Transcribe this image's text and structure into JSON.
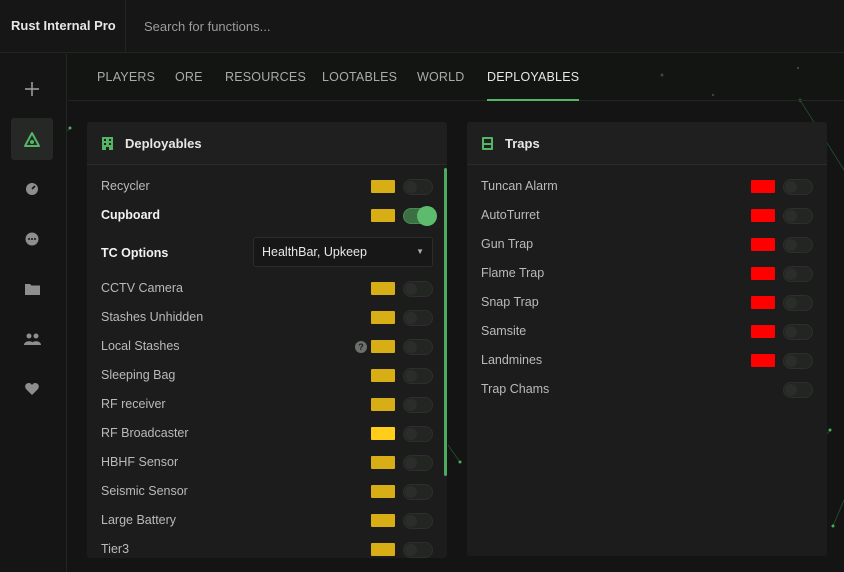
{
  "app": {
    "title": "Rust Internal Pro",
    "search_placeholder": "Search for functions..."
  },
  "sidebar": {
    "items": [
      {
        "icon": "crosshair-icon",
        "active": false
      },
      {
        "icon": "eye-triangle-icon",
        "active": true
      },
      {
        "icon": "gauge-icon",
        "active": false
      },
      {
        "icon": "chat-dots-icon",
        "active": false
      },
      {
        "icon": "folder-icon",
        "active": false
      },
      {
        "icon": "users-icon",
        "active": false
      },
      {
        "icon": "heart-icon",
        "active": false
      }
    ]
  },
  "tabs": [
    {
      "label": "PLAYERS",
      "active": false
    },
    {
      "label": "ORE",
      "active": false
    },
    {
      "label": "RESOURCES",
      "active": false
    },
    {
      "label": "LOOTABLES",
      "active": false
    },
    {
      "label": "WORLD",
      "active": false
    },
    {
      "label": "DEPLOYABLES",
      "active": true
    }
  ],
  "colors": {
    "accent": "#54b564",
    "swatch_yellow": "#d8ae17",
    "swatch_yellow_bright": "#ffcd1a",
    "swatch_red": "#ff0000"
  },
  "deployables": {
    "title": "Deployables",
    "icon": "building-icon",
    "tc_options": {
      "label": "TC Options",
      "value": "HealthBar, Upkeep"
    },
    "items": [
      {
        "label": "Recycler",
        "color": "#d8ae17",
        "on": false,
        "help": false
      },
      {
        "label": "Cupboard",
        "color": "#d8ae17",
        "on": true,
        "help": false
      },
      {
        "label": "CCTV Camera",
        "color": "#d8ae17",
        "on": false,
        "help": false
      },
      {
        "label": "Stashes Unhidden",
        "color": "#d8ae17",
        "on": false,
        "help": false
      },
      {
        "label": "Local Stashes",
        "color": "#d8ae17",
        "on": false,
        "help": true
      },
      {
        "label": "Sleeping Bag",
        "color": "#d8ae17",
        "on": false,
        "help": false
      },
      {
        "label": "RF receiver",
        "color": "#d8ae17",
        "on": false,
        "help": false
      },
      {
        "label": "RF Broadcaster",
        "color": "#ffcd1a",
        "on": false,
        "help": false
      },
      {
        "label": "HBHF Sensor",
        "color": "#d8ae17",
        "on": false,
        "help": false
      },
      {
        "label": "Seismic Sensor",
        "color": "#d8ae17",
        "on": false,
        "help": false
      },
      {
        "label": "Large Battery",
        "color": "#d8ae17",
        "on": false,
        "help": false
      },
      {
        "label": "Tier3",
        "color": "#d8ae17",
        "on": false,
        "help": false
      }
    ]
  },
  "traps": {
    "title": "Traps",
    "icon": "trap-box-icon",
    "items": [
      {
        "label": "Tuncan Alarm",
        "color": "#ff0000",
        "on": false
      },
      {
        "label": "AutoTurret",
        "color": "#ff0000",
        "on": false
      },
      {
        "label": "Gun Trap",
        "color": "#ff0000",
        "on": false
      },
      {
        "label": "Flame Trap",
        "color": "#ff0000",
        "on": false
      },
      {
        "label": "Snap Trap",
        "color": "#ff0000",
        "on": false
      },
      {
        "label": "Samsite",
        "color": "#ff0000",
        "on": false
      },
      {
        "label": "Landmines",
        "color": "#ff0000",
        "on": false
      },
      {
        "label": "Trap Chams",
        "color": "",
        "on": false
      }
    ]
  }
}
